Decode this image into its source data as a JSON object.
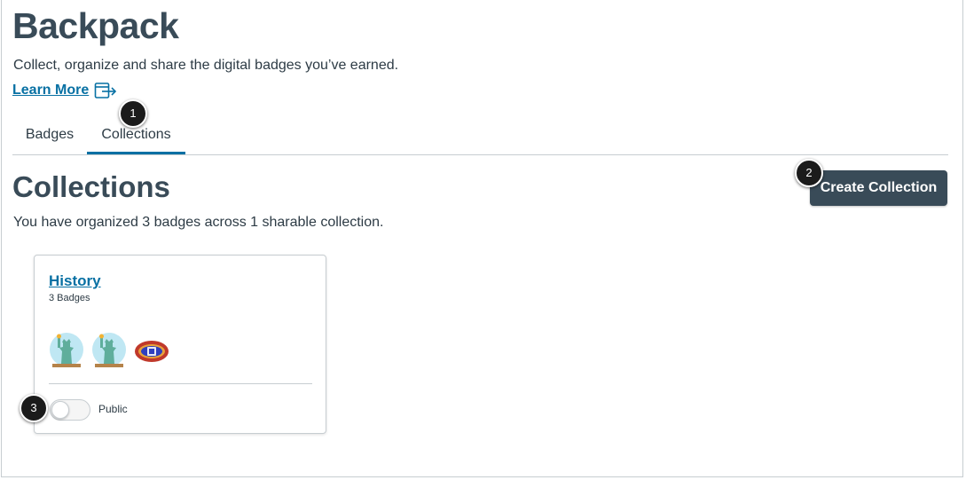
{
  "page": {
    "title": "Backpack",
    "subtitle": "Collect, organize and share the digital badges you’ve earned.",
    "learn_more_label": "Learn More",
    "learn_more_icon": "external-link-icon"
  },
  "tabs": [
    {
      "label": "Badges",
      "selected": false
    },
    {
      "label": "Collections",
      "selected": true
    }
  ],
  "section": {
    "title": "Collections",
    "description": "You have organized 3 badges across 1 sharable collection.",
    "create_button_label": "Create Collection"
  },
  "collections": [
    {
      "title": "History",
      "badge_count_label": "3 Badges",
      "badges": [
        {
          "icon": "statue-of-liberty-badge-icon"
        },
        {
          "icon": "statue-of-liberty-badge-icon"
        },
        {
          "icon": "emblem-badge-icon"
        }
      ],
      "toggle_label": "Public",
      "public": false
    }
  ],
  "callouts": [
    "1",
    "2",
    "3"
  ],
  "colors": {
    "heading": "#394b58",
    "link": "#0770a3",
    "button_bg": "#394b58",
    "tab_indicator": "#0770a3"
  }
}
